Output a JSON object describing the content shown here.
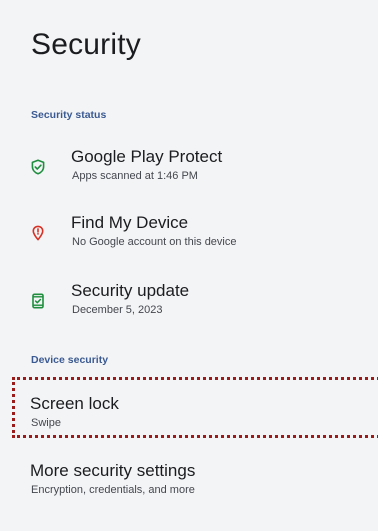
{
  "page": {
    "title": "Security"
  },
  "security_status": {
    "header": "Security status",
    "items": [
      {
        "primary": "Google Play Protect",
        "secondary": "Apps scanned at 1:46 PM",
        "icon": "shield-check-icon",
        "icon_color": "#1e8e3e"
      },
      {
        "primary": "Find My Device",
        "secondary": "No Google account on this device",
        "icon": "location-alert-icon",
        "icon_color": "#d93025"
      },
      {
        "primary": "Security update",
        "secondary": "December 5, 2023",
        "icon": "phone-check-icon",
        "icon_color": "#1e8e3e"
      }
    ]
  },
  "device_security": {
    "header": "Device security",
    "items": [
      {
        "primary": "Screen lock",
        "secondary": "Swipe",
        "highlighted": true
      },
      {
        "primary": "More security settings",
        "secondary": "Encryption, credentials, and more"
      }
    ]
  },
  "colors": {
    "background": "#f3f4f6",
    "section_header": "#3b5a92",
    "highlight_border": "#9b1b1b"
  }
}
